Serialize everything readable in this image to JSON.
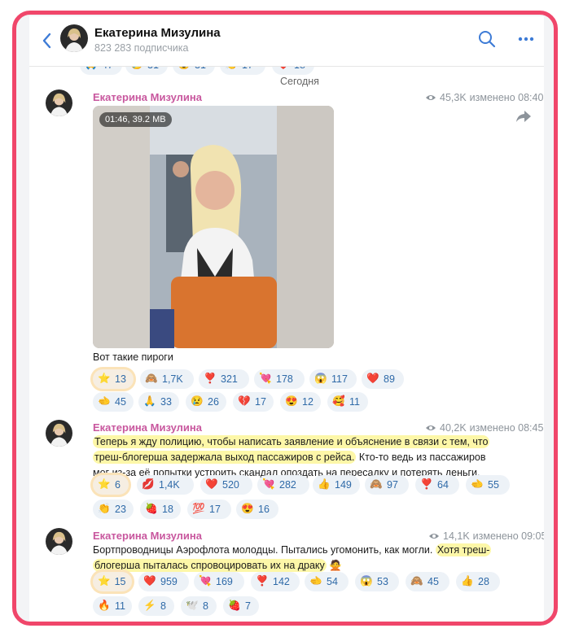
{
  "header": {
    "title": "Екатерина Мизулина",
    "subtitle": "823 283 подписчика"
  },
  "peek_row": {
    "chips": [
      {
        "emoji": "pray",
        "count": "47"
      },
      {
        "emoji": "cry",
        "count": "31"
      },
      {
        "emoji": "heart-eyes",
        "count": "31"
      },
      {
        "emoji": "clap",
        "count": "17"
      },
      {
        "emoji": "heart",
        "count": "18"
      }
    ],
    "date_separator": "Сегодня"
  },
  "posts": [
    {
      "author": "Екатерина Мизулина",
      "views": "45,3K",
      "edited": "изменено 08:40",
      "video_badge": "01:46, 39.2 MB",
      "caption": "Вот такие пироги",
      "reactions": [
        {
          "emoji": "star",
          "count": "13"
        },
        {
          "emoji": "see-no-evil",
          "count": "1,7K"
        },
        {
          "emoji": "heart-exclaim",
          "count": "321"
        },
        {
          "emoji": "heart-arrow",
          "count": "178"
        },
        {
          "emoji": "scream",
          "count": "117"
        },
        {
          "emoji": "heart",
          "count": "89"
        },
        {
          "emoji": "point-left",
          "count": "45"
        },
        {
          "emoji": "pray",
          "count": "33"
        },
        {
          "emoji": "sad",
          "count": "26"
        },
        {
          "emoji": "broken-heart",
          "count": "17"
        },
        {
          "emoji": "heart-eyes",
          "count": "12"
        },
        {
          "emoji": "hearts-face",
          "count": "11"
        }
      ]
    },
    {
      "author": "Екатерина Мизулина",
      "views": "40,2K",
      "edited": "изменено 08:45",
      "text_highlight_1": "Теперь я жду полицию, чтобы написать заявление и объяснение в связи с тем, что",
      "text_highlight_2": "треш-блогерша задержала выход пассажиров с рейса.",
      "text_rest_2": " Кто-то ведь из пассажиров",
      "text_line_3": "мог из-за её попытки устроить скандал опоздать на пересадку и потерять деньги.",
      "reactions": [
        {
          "emoji": "star",
          "count": "6"
        },
        {
          "emoji": "kiss",
          "count": "1,4K"
        },
        {
          "emoji": "heart",
          "count": "520"
        },
        {
          "emoji": "heart-arrow",
          "count": "282"
        },
        {
          "emoji": "thumbs-up",
          "count": "149"
        },
        {
          "emoji": "see-no-evil",
          "count": "97"
        },
        {
          "emoji": "heart-exclaim",
          "count": "64"
        },
        {
          "emoji": "point-left",
          "count": "55"
        },
        {
          "emoji": "clap",
          "count": "23"
        },
        {
          "emoji": "strawberry",
          "count": "18"
        },
        {
          "emoji": "hundred",
          "count": "17"
        },
        {
          "emoji": "heart-eyes",
          "count": "16"
        }
      ]
    },
    {
      "author": "Екатерина Мизулина",
      "views": "14,1K",
      "edited": "изменено 09:05",
      "text_line_1": "Бортпроводницы Аэрофлота молодцы. Пытались угомонить, как могли.",
      "text_highlight_1": "Хотя треш-",
      "text_highlight_2": "блогерша пыталась спровоцировать их на драку",
      "reactions": [
        {
          "emoji": "star",
          "count": "15"
        },
        {
          "emoji": "heart",
          "count": "959"
        },
        {
          "emoji": "heart-arrow",
          "count": "169"
        },
        {
          "emoji": "heart-exclaim",
          "count": "142"
        },
        {
          "emoji": "point-left",
          "count": "54"
        },
        {
          "emoji": "scream",
          "count": "53"
        },
        {
          "emoji": "see-no-evil",
          "count": "45"
        },
        {
          "emoji": "thumbs-up",
          "count": "28"
        },
        {
          "emoji": "fire",
          "count": "11"
        },
        {
          "emoji": "lightning",
          "count": "8"
        },
        {
          "emoji": "dove",
          "count": "8"
        },
        {
          "emoji": "strawberry",
          "count": "7"
        }
      ]
    }
  ],
  "colors": {
    "frame": "#f0466a",
    "author": "#c8579e",
    "chip_bg": "#edf2f7",
    "chip_text": "#2f6aa8",
    "highlight": "#fdf7a8",
    "accent": "#3d7bd6"
  }
}
